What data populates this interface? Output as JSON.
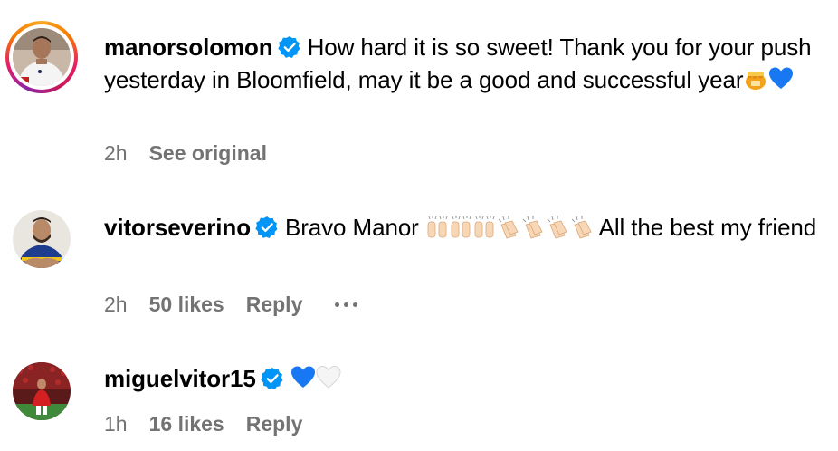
{
  "comments": [
    {
      "username": "manorsolomon",
      "text": "How hard it is so sweet! Thank you for your push yesterday in Bloomfield, may it be a good and successful year",
      "emoji": [
        "honey-pot-emoji",
        "blue-heart-emoji"
      ],
      "time": "2h",
      "action": "See original",
      "avatar_ring": true
    },
    {
      "username": "vitorseverino",
      "text_before": "Bravo Manor",
      "text_after": "All the best my friend",
      "emoji": [
        "raising-hands-emoji",
        "raising-hands-emoji",
        "raising-hands-emoji",
        "clapping-hands-emoji",
        "clapping-hands-emoji",
        "clapping-hands-emoji",
        "clapping-hands-emoji"
      ],
      "time": "2h",
      "likes": "50 likes",
      "reply": "Reply",
      "more": "more-options-icon"
    },
    {
      "username": "miguelvitor15",
      "emoji": [
        "blue-heart-emoji",
        "white-heart-emoji"
      ],
      "time": "1h",
      "likes": "16 likes",
      "reply": "Reply"
    }
  ],
  "colors": {
    "verified": "#0095f6",
    "meta": "#737373",
    "blue_heart": "#1877f2"
  }
}
